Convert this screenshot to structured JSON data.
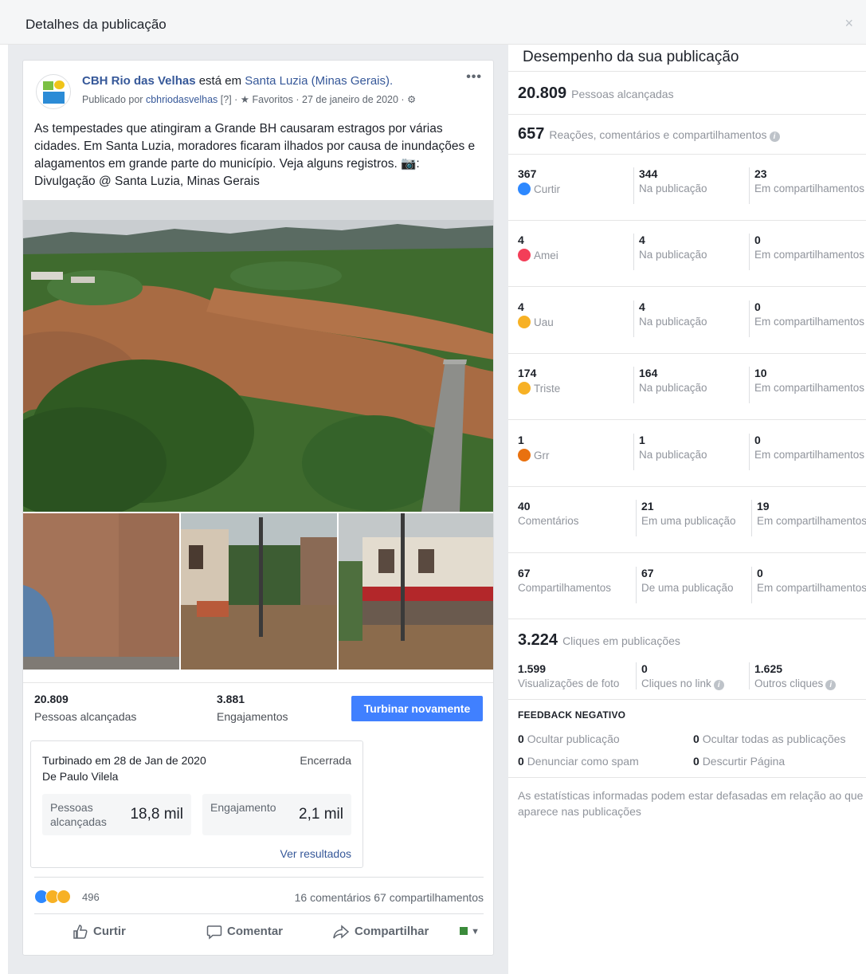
{
  "modal": {
    "title": "Detalhes da publicação",
    "close_label": "×"
  },
  "post": {
    "page_name": "CBH Rio das Velhas",
    "location_prefix": "está em",
    "location": "Santa Luzia (Minas Gerais).",
    "more_label": "•••",
    "meta_prefix": "Publicado por",
    "published_by": "cbhriodasvelhas",
    "help_mark": "[?]",
    "favorites": "Favoritos",
    "date": "27 de janeiro de 2020",
    "text": "As tempestades que atingiram a Grande BH causaram estragos por várias cidades. Em Santa Luzia, moradores ficaram ilhados por causa de inundações e alagamentos em grande parte do município. Veja alguns registros. 📷: Divulgação @ Santa Luzia, Minas Gerais"
  },
  "post_stats": {
    "reach_value": "20.809",
    "reach_label": "Pessoas alcançadas",
    "engagement_value": "3.881",
    "engagement_label": "Engajamentos",
    "boost_again_label": "Turbinar novamente"
  },
  "boost": {
    "title": "Turbinado em 28 de Jan de 2020",
    "by": "De Paulo Vilela",
    "status": "Encerrada",
    "metric1_label": "Pessoas alcançadas",
    "metric1_value": "18,8 mil",
    "metric2_label": "Engajamento com a...",
    "metric2_value": "2,1 mil",
    "results_link": "Ver resultados"
  },
  "reactions_summary": {
    "count": "496",
    "comments": "16 comentários",
    "shares": "67 compartilhamentos"
  },
  "actions": {
    "like": "Curtir",
    "comment": "Comentar",
    "share": "Compartilhar"
  },
  "performance": {
    "title": "Desempenho da sua publicação",
    "reach_value": "20.809",
    "reach_label": "Pessoas alcançadas",
    "reactions_value": "657",
    "reactions_label": "Reações, comentários e compartilhamentos",
    "rows": [
      {
        "total": "367",
        "label": "Curtir",
        "icon": "like-icon",
        "on_post": "344",
        "on_post_label": "Na publicação",
        "on_shares": "23",
        "on_shares_label": "Em compartilhamentos"
      },
      {
        "total": "4",
        "label": "Amei",
        "icon": "love-icon",
        "on_post": "4",
        "on_post_label": "Na publicação",
        "on_shares": "0",
        "on_shares_label": "Em compartilhamentos"
      },
      {
        "total": "4",
        "label": "Uau",
        "icon": "wow-icon",
        "on_post": "4",
        "on_post_label": "Na publicação",
        "on_shares": "0",
        "on_shares_label": "Em compartilhamentos"
      },
      {
        "total": "174",
        "label": "Triste",
        "icon": "sad-icon",
        "on_post": "164",
        "on_post_label": "Na publicação",
        "on_shares": "10",
        "on_shares_label": "Em compartilhamentos"
      },
      {
        "total": "1",
        "label": "Grr",
        "icon": "angry-icon",
        "on_post": "1",
        "on_post_label": "Na publicação",
        "on_shares": "0",
        "on_shares_label": "Em compartilhamentos"
      },
      {
        "total": "40",
        "label": "Comentários",
        "icon": "",
        "on_post": "21",
        "on_post_label": "Em uma publicação",
        "on_shares": "19",
        "on_shares_label": "Em compartilhamentos"
      },
      {
        "total": "67",
        "label": "Compartilhamentos",
        "icon": "",
        "on_post": "67",
        "on_post_label": "De uma publicação",
        "on_shares": "0",
        "on_shares_label": "Em compartilhamentos"
      }
    ],
    "clicks_value": "3.224",
    "clicks_label": "Cliques em publicações",
    "photo_views_value": "1.599",
    "photo_views_label": "Visualizações de foto",
    "link_clicks_value": "0",
    "link_clicks_label": "Cliques no link",
    "other_clicks_value": "1.625",
    "other_clicks_label": "Outros cliques",
    "negative_title": "FEEDBACK NEGATIVO",
    "hide_post_value": "0",
    "hide_post_label": "Ocultar publicação",
    "hide_all_value": "0",
    "hide_all_label": "Ocultar todas as publicações",
    "report_spam_value": "0",
    "report_spam_label": "Denunciar como spam",
    "unlike_page_value": "0",
    "unlike_page_label": "Descurtir Página",
    "footnote": "As estatísticas informadas podem estar defasadas em relação ao que aparece nas publicações"
  },
  "colors": {
    "accent": "#4080ff",
    "link": "#365899",
    "like": "#2d88ff",
    "love": "#f33e58",
    "wow": "#f7b125",
    "angry": "#e9710f"
  }
}
